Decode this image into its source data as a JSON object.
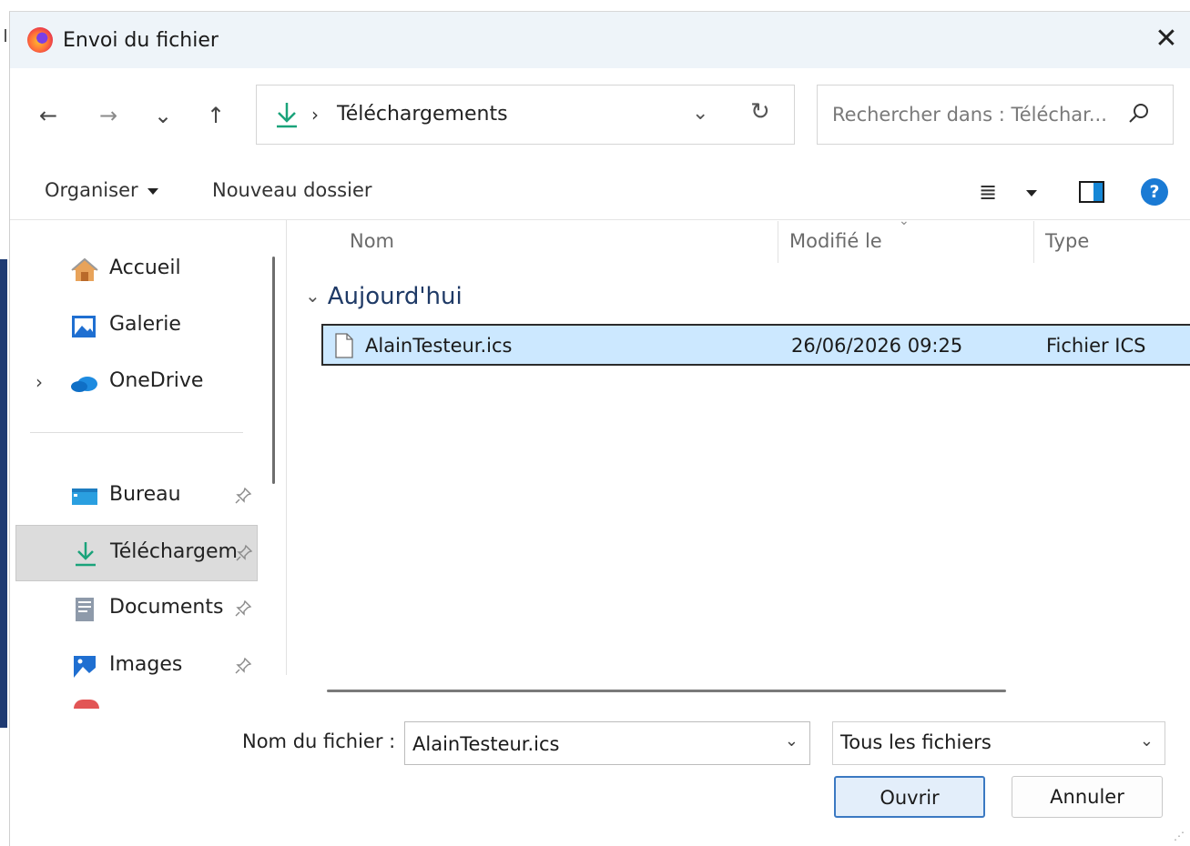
{
  "window": {
    "title": "Envoi du fichier",
    "close_glyph": "✕"
  },
  "nav": {
    "back": "←",
    "forward": "→",
    "recent": "⌄",
    "up": "↑"
  },
  "address": {
    "separator": "›",
    "location": "Téléchargements",
    "chevron": "⌄",
    "refresh": "↻"
  },
  "search": {
    "placeholder": "Rechercher dans : Téléchar..."
  },
  "toolbar": {
    "organize_label": "Organiser",
    "new_folder_label": "Nouveau dossier",
    "view_glyph": "≣",
    "help_glyph": "?"
  },
  "sidebar": {
    "items": [
      {
        "label": "Accueil",
        "icon": "home-icon",
        "expander": ""
      },
      {
        "label": "Galerie",
        "icon": "gallery-icon",
        "expander": ""
      },
      {
        "label": "OneDrive",
        "icon": "onedrive-icon",
        "expander": "›"
      },
      {
        "label": "Bureau",
        "icon": "desktop-icon",
        "pinned": true
      },
      {
        "label": "Téléchargem",
        "icon": "download-icon",
        "pinned": true,
        "selected": true
      },
      {
        "label": "Documents",
        "icon": "documents-icon",
        "pinned": true
      },
      {
        "label": "Images",
        "icon": "images-icon",
        "pinned": true
      }
    ]
  },
  "columns": {
    "name": "Nom",
    "modified": "Modifié le",
    "type": "Type"
  },
  "group": {
    "label": "Aujourd'hui",
    "chevron": "⌄"
  },
  "files": [
    {
      "name": "AlainTesteur.ics",
      "modified": "26/06/2026 09:25",
      "type": "Fichier ICS",
      "selected": true
    }
  ],
  "footer": {
    "filename_label": "Nom du fichier :",
    "filename_value": "AlainTesteur.ics",
    "filter_value": "Tous les fichiers",
    "open_label": "Ouvrir",
    "cancel_label": "Annuler",
    "chevron": "⌄"
  },
  "colors": {
    "accent": "#1a7ad4",
    "selection": "#cce8ff",
    "titlebar": "#eef4f9",
    "download_green": "#1aa37a"
  }
}
